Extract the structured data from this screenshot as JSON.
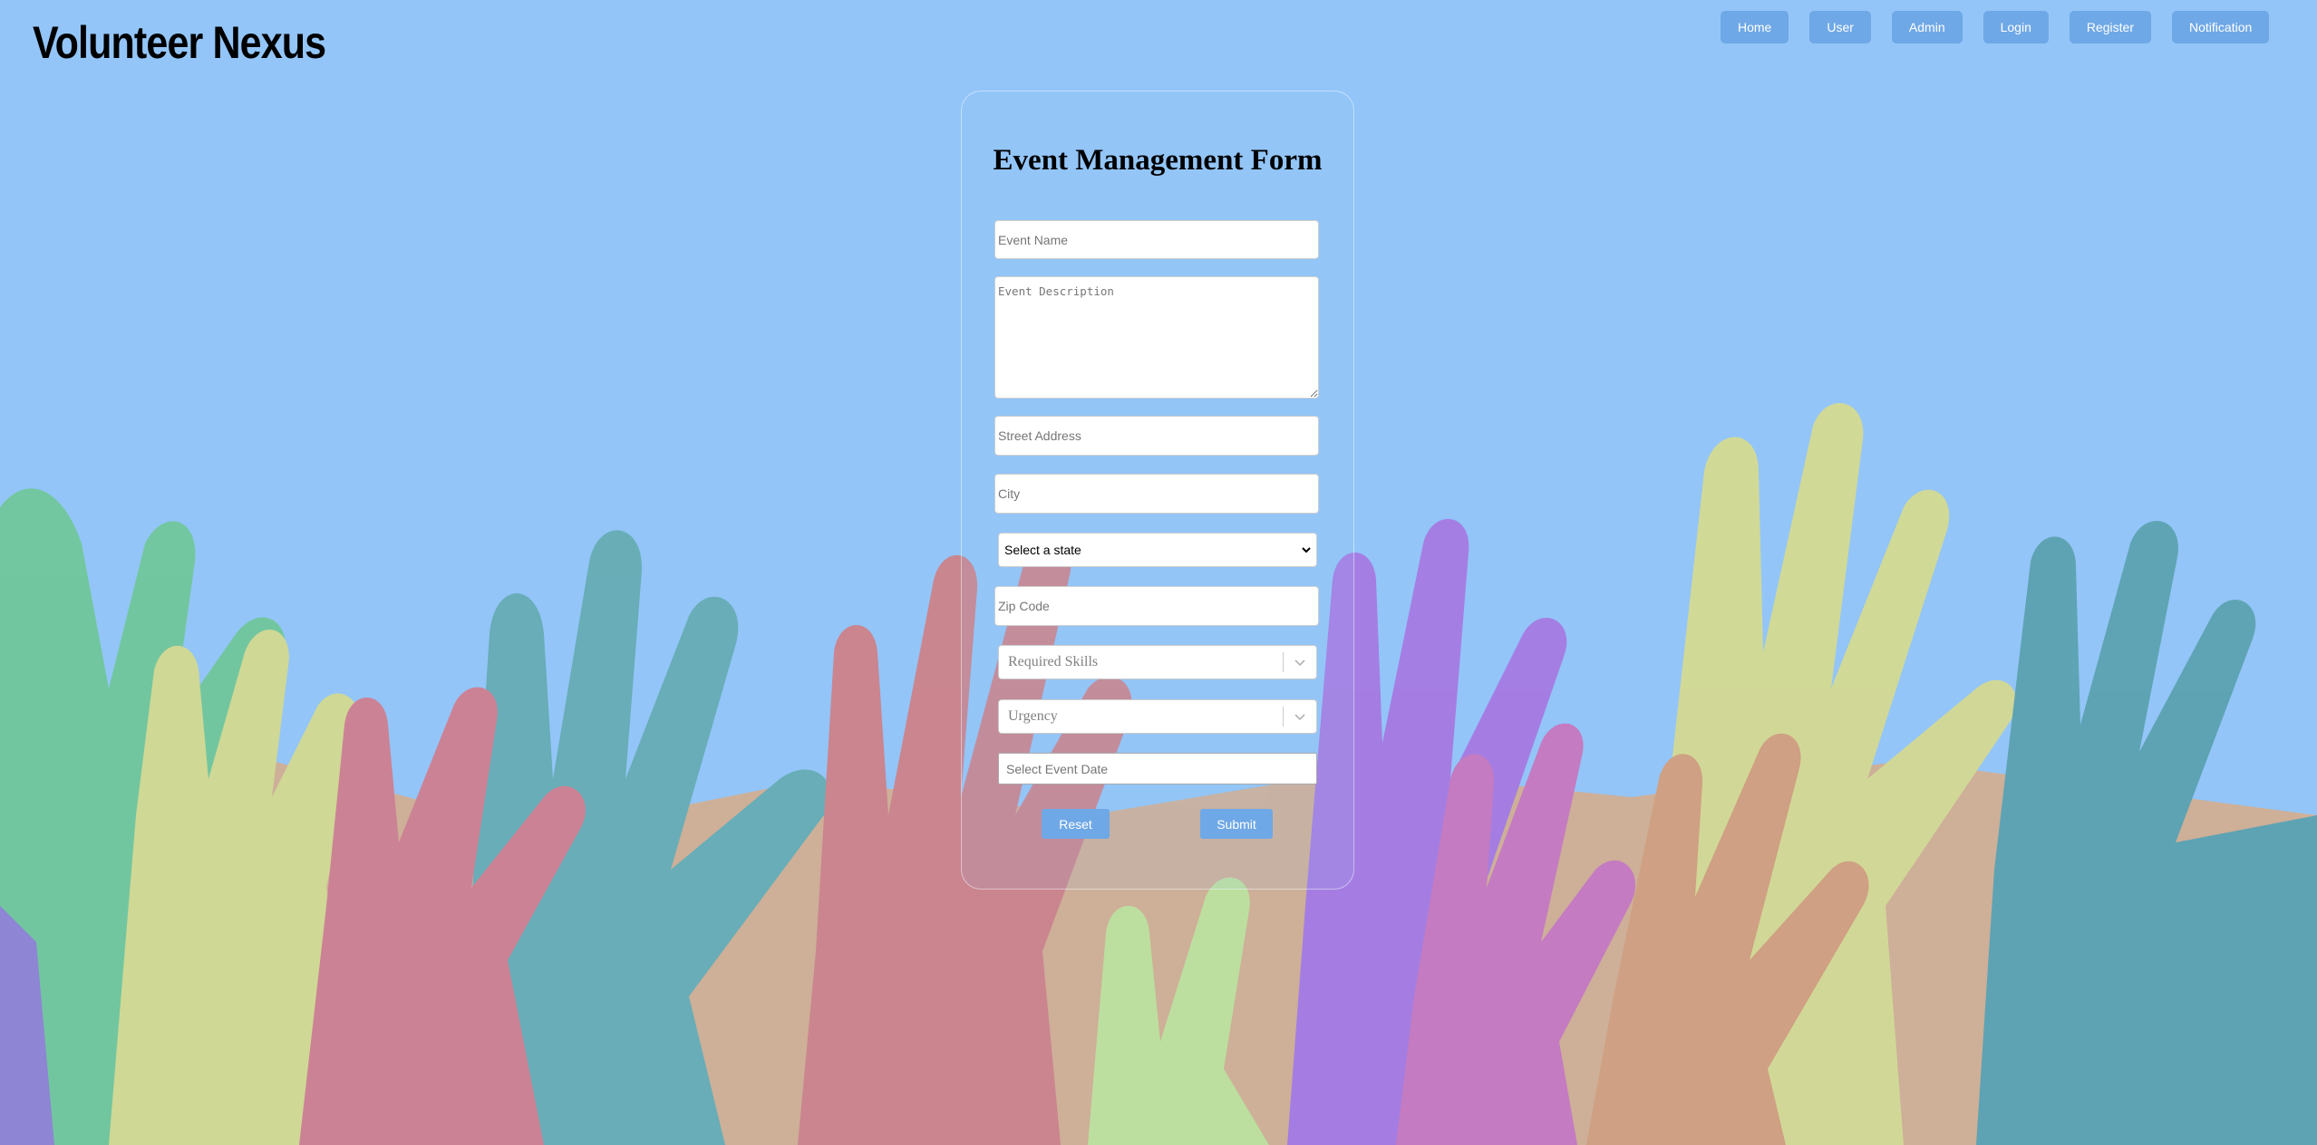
{
  "header": {
    "brand": "Volunteer Nexus",
    "nav": [
      "Home",
      "User",
      "Admin",
      "Login",
      "Register",
      "Notification"
    ]
  },
  "form": {
    "title": "Event Management Form",
    "event_name_placeholder": "Event Name",
    "event_description_placeholder": "Event Description",
    "street_address_placeholder": "Street Address",
    "city_placeholder": "City",
    "state_selected": "Select a state",
    "zip_placeholder": "Zip Code",
    "skills_placeholder": "Required Skills",
    "urgency_placeholder": "Urgency",
    "date_placeholder": "Select Event Date",
    "reset_label": "Reset",
    "submit_label": "Submit"
  },
  "colors": {
    "background": "#93c5f8",
    "button": "#6fa8e6"
  }
}
